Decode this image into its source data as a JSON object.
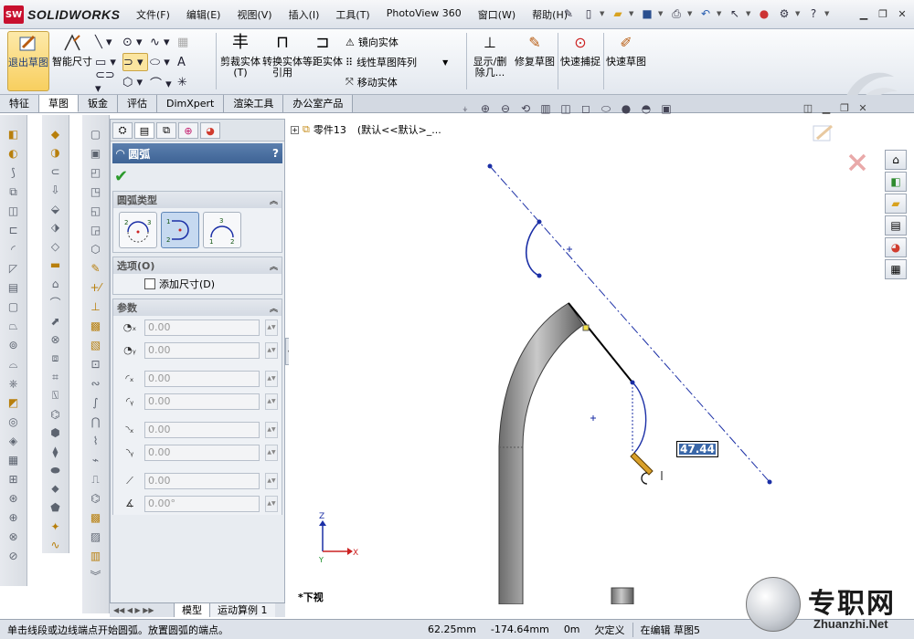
{
  "app": {
    "logo_text": "SOLIDWORKS",
    "logo_badge": "SW"
  },
  "menu": [
    "文件(F)",
    "编辑(E)",
    "视图(V)",
    "插入(I)",
    "工具(T)",
    "PhotoView 360",
    "窗口(W)",
    "帮助(H)"
  ],
  "commands": {
    "exit_sketch": "退出草图",
    "smart_dim": "智能尺寸",
    "trim": "剪裁实体(T)",
    "convert": "转换实体引用",
    "offset": "等距实体",
    "mirror": "镜向实体",
    "linear_pattern": "线性草图阵列",
    "move": "移动实体",
    "show_delete": "显示/删除几...",
    "repair": "修复草图",
    "quick_snap": "快速捕捉",
    "rapid_sketch": "快速草图"
  },
  "tabs": [
    "特征",
    "草图",
    "钣金",
    "评估",
    "DimXpert",
    "渲染工具",
    "办公室产品"
  ],
  "active_tab": "草图",
  "property_manager": {
    "title": "圆弧",
    "help": "?",
    "group_arc_type": "圆弧类型",
    "group_options": "选项(O)",
    "add_dimension": "添加尺寸(D)",
    "group_params": "参数",
    "params": {
      "cx": "0.00",
      "cy": "0.00",
      "sx": "0.00",
      "sy": "0.00",
      "ex": "0.00",
      "ey": "0.00",
      "radius": "0.00",
      "angle": "0.00°"
    }
  },
  "bottom_tabs": [
    "模型",
    "运动算例 1"
  ],
  "tree": {
    "root": "零件13",
    "config": "(默认<<默认>_..."
  },
  "view_name": "*下视",
  "dimension_value": "47.44",
  "axes": {
    "x": "X",
    "y": "Y",
    "z": "Z"
  },
  "status": {
    "message": "单击线段或边线端点开始圆弧。放置圆弧的端点。",
    "x": "62.25mm",
    "y": "-174.64mm",
    "z": "0m",
    "defined": "欠定义",
    "editing": "在编辑 草图5"
  },
  "watermark": {
    "cn": "专职网",
    "url": "Zhuanzhi.Net"
  },
  "colors": {
    "accent": "#3e6395",
    "sketch_blue": "#1b2fa6",
    "active_yellow": "#f8cf5f"
  }
}
